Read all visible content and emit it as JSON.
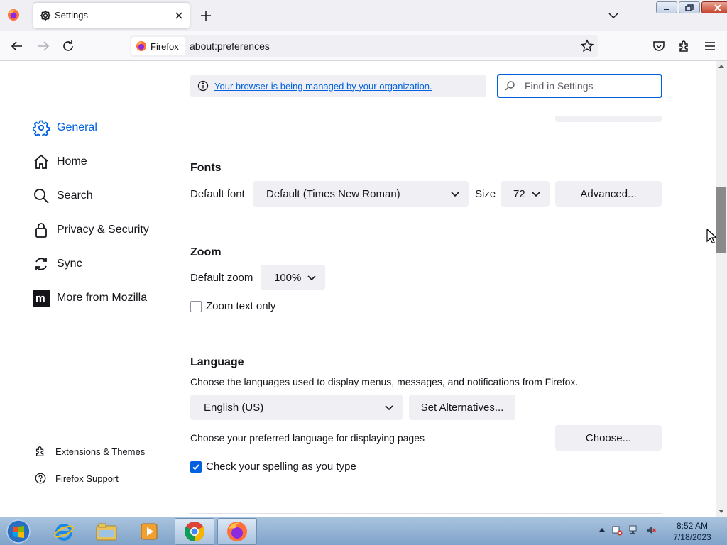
{
  "browser": {
    "tab_title": "Settings",
    "identity_label": "Firefox",
    "url": "about:preferences"
  },
  "policy_notice": "Your browser is being managed by your organization.",
  "search": {
    "placeholder": "Find in Settings"
  },
  "sidebar": {
    "items": [
      {
        "label": "General",
        "icon": "gear-icon",
        "active": true
      },
      {
        "label": "Home",
        "icon": "home-icon"
      },
      {
        "label": "Search",
        "icon": "search-icon"
      },
      {
        "label": "Privacy & Security",
        "icon": "lock-icon"
      },
      {
        "label": "Sync",
        "icon": "sync-icon"
      },
      {
        "label": "More from Mozilla",
        "icon": "mozilla-icon"
      }
    ],
    "footer": [
      {
        "label": "Extensions & Themes",
        "icon": "puzzle-icon"
      },
      {
        "label": "Firefox Support",
        "icon": "help-icon"
      }
    ]
  },
  "fonts": {
    "heading": "Fonts",
    "default_font_label": "Default font",
    "default_font_value": "Default (Times New Roman)",
    "size_label": "Size",
    "size_value": "72",
    "advanced_button": "Advanced..."
  },
  "zoom": {
    "heading": "Zoom",
    "default_zoom_label": "Default zoom",
    "default_zoom_value": "100%",
    "zoom_text_only_label": "Zoom text only",
    "zoom_text_only_checked": false
  },
  "language": {
    "heading": "Language",
    "description": "Choose the languages used to display menus, messages, and notifications from Firefox.",
    "language_value": "English (US)",
    "set_alternatives_button": "Set Alternatives...",
    "pages_label": "Choose your preferred language for displaying pages",
    "choose_button": "Choose...",
    "spelling_label": "Check your spelling as you type",
    "spelling_checked": true
  },
  "taskbar": {
    "time": "8:52 AM",
    "date": "7/18/2023"
  },
  "colors": {
    "accent": "#0061e0",
    "button_bg": "#f0f0f4"
  }
}
